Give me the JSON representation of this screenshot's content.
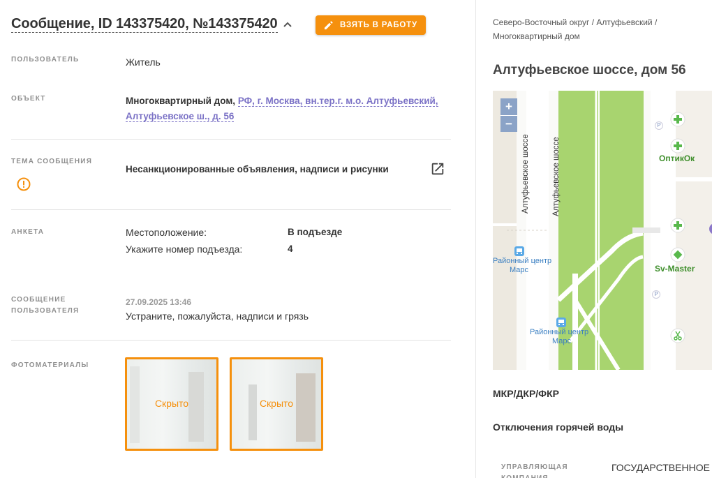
{
  "header": {
    "title": "Сообщение, ID 143375420, №143375420",
    "take_button": "ВЗЯТЬ В РАБОТУ"
  },
  "fields": {
    "user_label": "ПОЛЬЗОВАТЕЛЬ",
    "user_value": "Житель",
    "object_label": "ОБЪЕКТ",
    "object_type": "Многоквартирный дом,",
    "object_address": "РФ, г. Москва, вн.тер.г. м.о. Алтуфьевский, Алтуфьевское ш., д. 56",
    "topic_label": "ТЕМА СООБЩЕНИЯ",
    "topic_value": "Несанкционированные объявления, надписи и рисунки",
    "survey_label": "АНКЕТА",
    "survey": [
      {
        "question": "Местоположение:",
        "answer": "В подъезде"
      },
      {
        "question": "Укажите номер подъезда:",
        "answer": "4"
      }
    ],
    "message_label_1": "СООБЩЕНИЕ",
    "message_label_2": "ПОЛЬЗОВАТЕЛЯ",
    "message_date": "27.09.2025 13:46",
    "message_text": "Устраните, пожалуйста, надписи и грязь",
    "photos_label": "ФОТОМАТЕРИАЛЫ",
    "photos": [
      {
        "caption": "Скрыто"
      },
      {
        "caption": "Скрыто"
      }
    ]
  },
  "sidebar": {
    "breadcrumb_1": "Северо-Восточный округ / Алтуфьевский /",
    "breadcrumb_2": "Многоквартирный дом",
    "address": "Алтуфьевское шоссе, дом 56",
    "map": {
      "zoom_in": "+",
      "zoom_out": "−",
      "street_1": "Алтуфьевское шоссе",
      "street_2": "Алтуфьевское шоссе",
      "poi_1": "ОптикОк",
      "poi_2": "Sv-Master",
      "poi_3a": "Районный центр",
      "poi_3b": "Марс",
      "poi_4a": "Районный центр",
      "poi_4b": "Марс",
      "parking": "P"
    },
    "section_1": "МКР/ДКР/ФКР",
    "section_2": "Отключения горячей воды",
    "manager_label": "УПРАВЛЯЮЩАЯ КОМПАНИЯ",
    "manager_value": "ГОСУДАРСТВЕННОЕ БЮ"
  },
  "colors": {
    "accent_orange": "#f5900d",
    "link_purple": "#7b72c6",
    "map_green": "#a8d46f"
  }
}
